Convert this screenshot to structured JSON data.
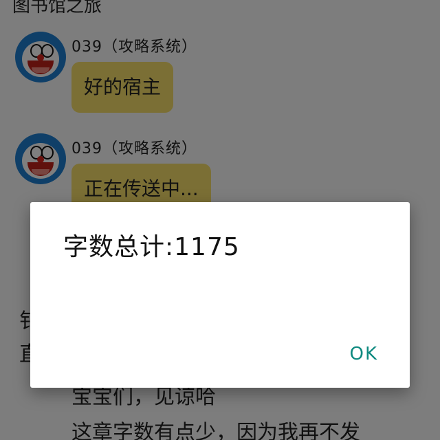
{
  "header": {
    "title": "图书馆之旅"
  },
  "messages": [
    {
      "sender": "039（攻略系统）",
      "text": "好的宿主"
    },
    {
      "sender": "039（攻略系统）",
      "text": "正在传送中..."
    }
  ],
  "background_text": {
    "line_left_1": "钅",
    "line_left_2": "直",
    "line_3": "宝宝们，见谅哈",
    "line_4": "这章字数有点少，因为我再不发"
  },
  "dialog": {
    "message": "字数总计:1175",
    "ok_label": "OK"
  },
  "colors": {
    "bubble": "#f6df6a",
    "accent": "#0f8a80",
    "scrim": "rgba(0,0,0,0.5)"
  },
  "icons": {
    "avatar": "doraemon-avatar-icon"
  }
}
